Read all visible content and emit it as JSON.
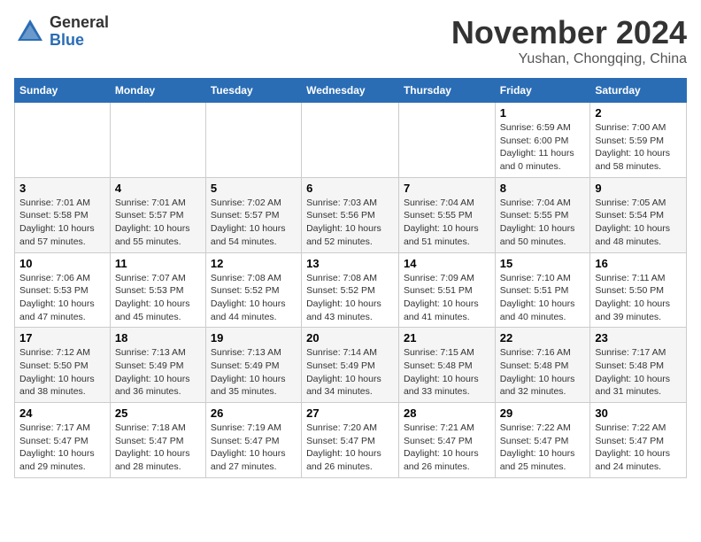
{
  "logo": {
    "general": "General",
    "blue": "Blue"
  },
  "title": "November 2024",
  "subtitle": "Yushan, Chongqing, China",
  "days_of_week": [
    "Sunday",
    "Monday",
    "Tuesday",
    "Wednesday",
    "Thursday",
    "Friday",
    "Saturday"
  ],
  "weeks": [
    [
      {
        "day": "",
        "detail": ""
      },
      {
        "day": "",
        "detail": ""
      },
      {
        "day": "",
        "detail": ""
      },
      {
        "day": "",
        "detail": ""
      },
      {
        "day": "",
        "detail": ""
      },
      {
        "day": "1",
        "detail": "Sunrise: 6:59 AM\nSunset: 6:00 PM\nDaylight: 11 hours\nand 0 minutes."
      },
      {
        "day": "2",
        "detail": "Sunrise: 7:00 AM\nSunset: 5:59 PM\nDaylight: 10 hours\nand 58 minutes."
      }
    ],
    [
      {
        "day": "3",
        "detail": "Sunrise: 7:01 AM\nSunset: 5:58 PM\nDaylight: 10 hours\nand 57 minutes."
      },
      {
        "day": "4",
        "detail": "Sunrise: 7:01 AM\nSunset: 5:57 PM\nDaylight: 10 hours\nand 55 minutes."
      },
      {
        "day": "5",
        "detail": "Sunrise: 7:02 AM\nSunset: 5:57 PM\nDaylight: 10 hours\nand 54 minutes."
      },
      {
        "day": "6",
        "detail": "Sunrise: 7:03 AM\nSunset: 5:56 PM\nDaylight: 10 hours\nand 52 minutes."
      },
      {
        "day": "7",
        "detail": "Sunrise: 7:04 AM\nSunset: 5:55 PM\nDaylight: 10 hours\nand 51 minutes."
      },
      {
        "day": "8",
        "detail": "Sunrise: 7:04 AM\nSunset: 5:55 PM\nDaylight: 10 hours\nand 50 minutes."
      },
      {
        "day": "9",
        "detail": "Sunrise: 7:05 AM\nSunset: 5:54 PM\nDaylight: 10 hours\nand 48 minutes."
      }
    ],
    [
      {
        "day": "10",
        "detail": "Sunrise: 7:06 AM\nSunset: 5:53 PM\nDaylight: 10 hours\nand 47 minutes."
      },
      {
        "day": "11",
        "detail": "Sunrise: 7:07 AM\nSunset: 5:53 PM\nDaylight: 10 hours\nand 45 minutes."
      },
      {
        "day": "12",
        "detail": "Sunrise: 7:08 AM\nSunset: 5:52 PM\nDaylight: 10 hours\nand 44 minutes."
      },
      {
        "day": "13",
        "detail": "Sunrise: 7:08 AM\nSunset: 5:52 PM\nDaylight: 10 hours\nand 43 minutes."
      },
      {
        "day": "14",
        "detail": "Sunrise: 7:09 AM\nSunset: 5:51 PM\nDaylight: 10 hours\nand 41 minutes."
      },
      {
        "day": "15",
        "detail": "Sunrise: 7:10 AM\nSunset: 5:51 PM\nDaylight: 10 hours\nand 40 minutes."
      },
      {
        "day": "16",
        "detail": "Sunrise: 7:11 AM\nSunset: 5:50 PM\nDaylight: 10 hours\nand 39 minutes."
      }
    ],
    [
      {
        "day": "17",
        "detail": "Sunrise: 7:12 AM\nSunset: 5:50 PM\nDaylight: 10 hours\nand 38 minutes."
      },
      {
        "day": "18",
        "detail": "Sunrise: 7:13 AM\nSunset: 5:49 PM\nDaylight: 10 hours\nand 36 minutes."
      },
      {
        "day": "19",
        "detail": "Sunrise: 7:13 AM\nSunset: 5:49 PM\nDaylight: 10 hours\nand 35 minutes."
      },
      {
        "day": "20",
        "detail": "Sunrise: 7:14 AM\nSunset: 5:49 PM\nDaylight: 10 hours\nand 34 minutes."
      },
      {
        "day": "21",
        "detail": "Sunrise: 7:15 AM\nSunset: 5:48 PM\nDaylight: 10 hours\nand 33 minutes."
      },
      {
        "day": "22",
        "detail": "Sunrise: 7:16 AM\nSunset: 5:48 PM\nDaylight: 10 hours\nand 32 minutes."
      },
      {
        "day": "23",
        "detail": "Sunrise: 7:17 AM\nSunset: 5:48 PM\nDaylight: 10 hours\nand 31 minutes."
      }
    ],
    [
      {
        "day": "24",
        "detail": "Sunrise: 7:17 AM\nSunset: 5:47 PM\nDaylight: 10 hours\nand 29 minutes."
      },
      {
        "day": "25",
        "detail": "Sunrise: 7:18 AM\nSunset: 5:47 PM\nDaylight: 10 hours\nand 28 minutes."
      },
      {
        "day": "26",
        "detail": "Sunrise: 7:19 AM\nSunset: 5:47 PM\nDaylight: 10 hours\nand 27 minutes."
      },
      {
        "day": "27",
        "detail": "Sunrise: 7:20 AM\nSunset: 5:47 PM\nDaylight: 10 hours\nand 26 minutes."
      },
      {
        "day": "28",
        "detail": "Sunrise: 7:21 AM\nSunset: 5:47 PM\nDaylight: 10 hours\nand 26 minutes."
      },
      {
        "day": "29",
        "detail": "Sunrise: 7:22 AM\nSunset: 5:47 PM\nDaylight: 10 hours\nand 25 minutes."
      },
      {
        "day": "30",
        "detail": "Sunrise: 7:22 AM\nSunset: 5:47 PM\nDaylight: 10 hours\nand 24 minutes."
      }
    ]
  ]
}
